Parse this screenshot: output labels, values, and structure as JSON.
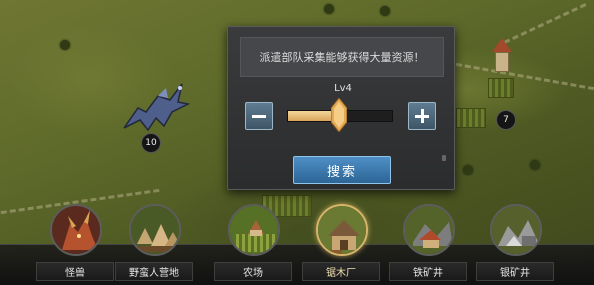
{
  "popup": {
    "hint": "派遣部队采集能够获得大量资源！",
    "level_label": "Lv4",
    "level_fraction": 0.45,
    "search_label": "搜索"
  },
  "map": {
    "dragon_level": "10",
    "tower_level": "7"
  },
  "categories": [
    {
      "label": "怪兽",
      "icon": "monster-icon"
    },
    {
      "label": "野蛮人营地",
      "icon": "barbarian-camp-icon"
    },
    {
      "label": "农场",
      "icon": "farm-icon"
    },
    {
      "label": "锯木厂",
      "icon": "sawmill-icon",
      "selected": true
    },
    {
      "label": "铁矿井",
      "icon": "iron-mine-icon"
    },
    {
      "label": "银矿井",
      "icon": "silver-mine-icon"
    }
  ],
  "colors": {
    "accent_button": "#3b7ab0",
    "slider_fill": "#e8c07a",
    "selected_ring": "#d7b56b"
  }
}
